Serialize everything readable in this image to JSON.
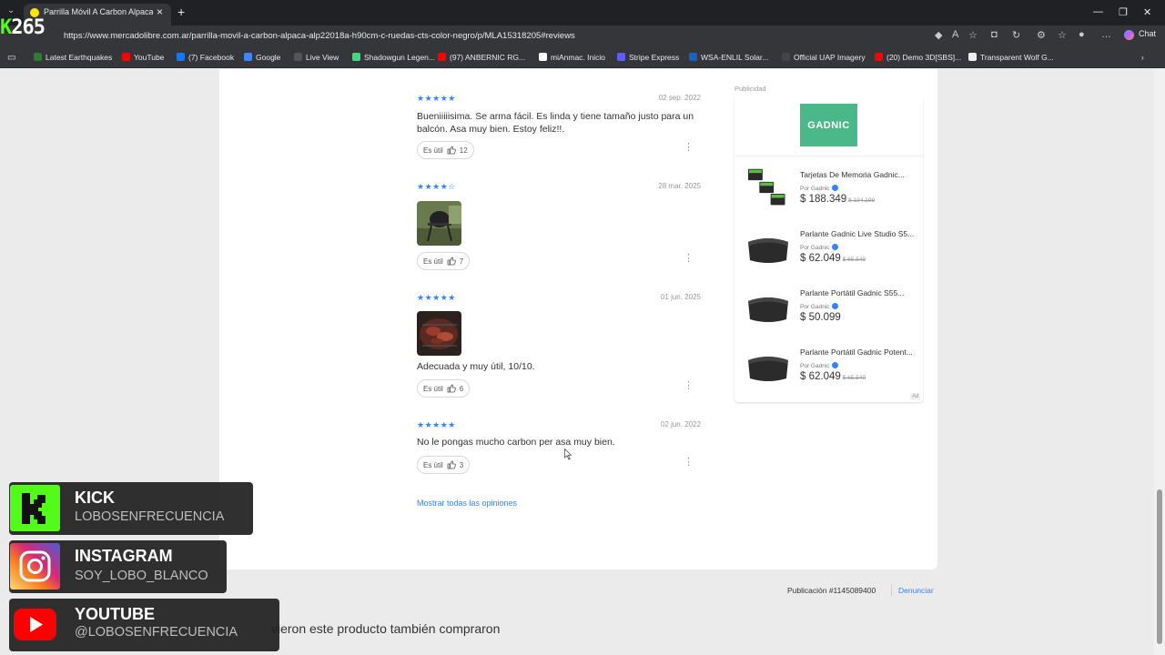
{
  "browser": {
    "tab_title": "Parrilla Móvil A Carbon Alpaca Alp",
    "url": "https://www.mercadolibre.com.ar/parrilla-movil-a-carbon-alpaca-alp22018a-h90cm-c-ruedas-cts-color-negro/p/MLA15318205#reviews",
    "chat_label": "Chat",
    "bookmarks": [
      {
        "label": "Latest Earthquakes",
        "color": "#2e7d32"
      },
      {
        "label": "YouTube",
        "color": "#ff0000"
      },
      {
        "label": "(7) Facebook",
        "color": "#1877f2"
      },
      {
        "label": "Google",
        "color": "#4285f4"
      },
      {
        "label": "Live View",
        "color": "#555555"
      },
      {
        "label": "Shadowgun Legen...",
        "color": "#3ddc84"
      },
      {
        "label": "(97) ANBERNIC RG...",
        "color": "#ff0000"
      },
      {
        "label": "miAnmac. Inicio",
        "color": "#ffffff"
      },
      {
        "label": "Stripe Express",
        "color": "#635bff"
      },
      {
        "label": "WSA-ENLIL Solar...",
        "color": "#1565c0"
      },
      {
        "label": "Official UAP Imagery",
        "color": "#444444"
      },
      {
        "label": "(20) Demo 3D[SBS]...",
        "color": "#ff0000"
      },
      {
        "label": "Transparent Wolf G...",
        "color": "#eeeeee"
      }
    ]
  },
  "overlay_logo": {
    "k": "K",
    "num": "265"
  },
  "reviews": [
    {
      "stars": "★★★★★",
      "date": "02 sep. 2022",
      "text": "Bueniiiiisima. Se arma fácil. Es linda y tiene tamaño justo para un balcón. Asa muy bien. Estoy feliz!!.",
      "util_label": "Es útil",
      "util_count": "12"
    },
    {
      "stars": "★★★★☆",
      "date": "28 mar. 2025",
      "text": "",
      "util_label": "Es útil",
      "util_count": "7"
    },
    {
      "stars": "★★★★★",
      "date": "01 jun. 2025",
      "text": "Adecuada y muy útil, 10/10.",
      "util_label": "Es útil",
      "util_count": "6"
    },
    {
      "stars": "★★★★★",
      "date": "02 jun. 2022",
      "text": "No le pongas mucho carbon per asa muy bien.",
      "util_label": "Es útil",
      "util_count": "3"
    }
  ],
  "show_all_label": "Mostrar todas las opiniones",
  "ads": {
    "label": "Publicidad",
    "brand": "GADNIC",
    "tag": "Ad",
    "items": [
      {
        "title": "Tarjetas De Memoria Gadnic...",
        "seller": "Por Gadnic",
        "price": "$ 188.349",
        "old_price": "$ 194.199"
      },
      {
        "title": "Parlante Gadnic Live Studio S5...",
        "seller": "Por Gadnic",
        "price": "$ 62.049",
        "old_price": "$ 65.549"
      },
      {
        "title": "Parlante Portátil Gadnic S55...",
        "seller": "Por Gadnic",
        "price": "$ 50.099",
        "old_price": ""
      },
      {
        "title": "Parlante Portátil Gadnic Potent...",
        "seller": "Por Gadnic",
        "price": "$ 62.049",
        "old_price": "$ 65.549"
      }
    ]
  },
  "publicacion": "Publicación #1145089400",
  "denunciar": "Denunciar",
  "also_bought": "vieron este producto también compraron",
  "social": {
    "kick": {
      "title": "KICK",
      "sub": "LOBOSENFRECUENCIA",
      "color": "#53fc18"
    },
    "instagram": {
      "title": "INSTAGRAM",
      "sub": "SOY_LOBO_BLANCO"
    },
    "youtube": {
      "title": "YOUTUBE",
      "sub": "@LOBOSENFRECUENCIA",
      "color": "#ff0000"
    }
  }
}
